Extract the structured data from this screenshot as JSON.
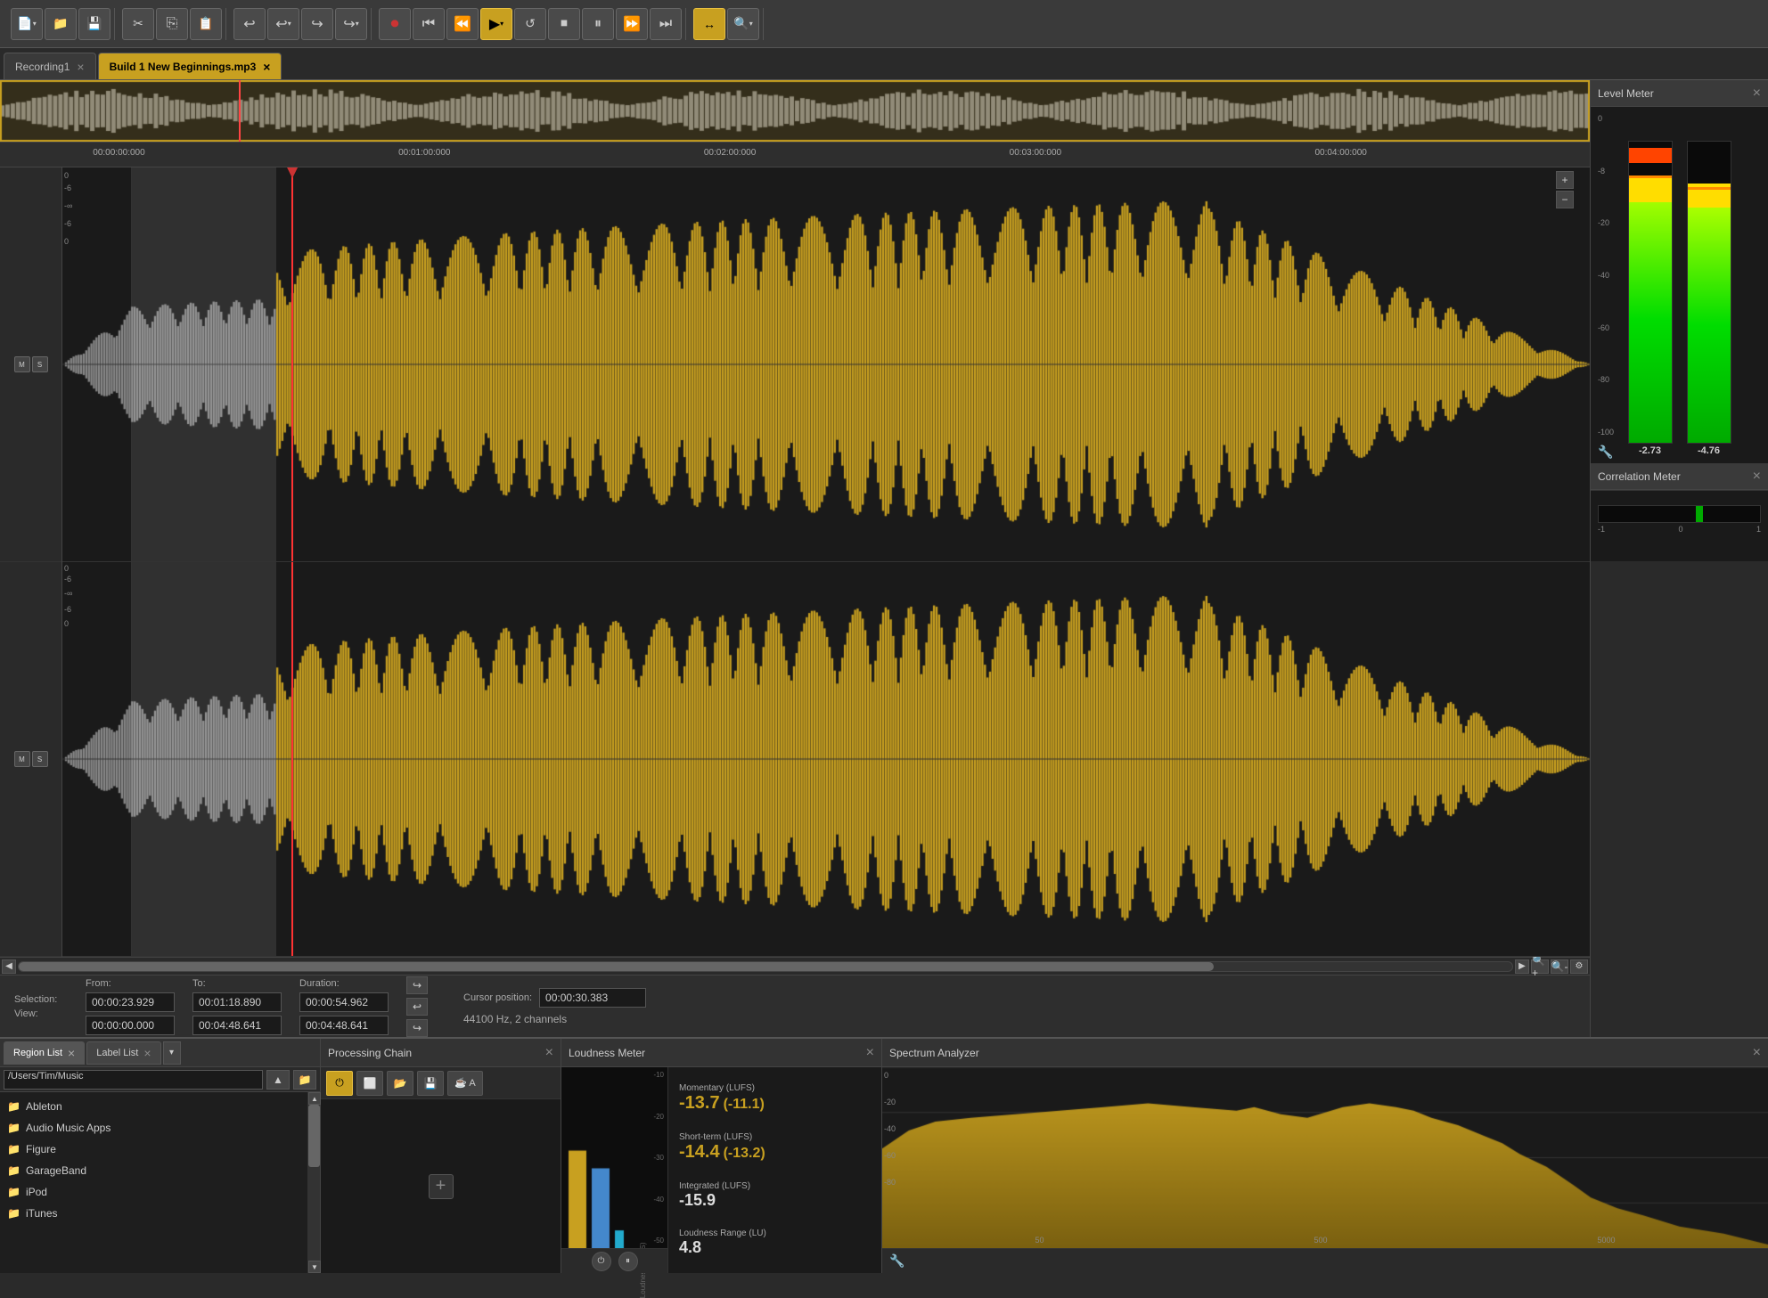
{
  "toolbar": {
    "buttons": [
      {
        "id": "new",
        "label": "📄▾",
        "icon": "new-file-icon"
      },
      {
        "id": "open",
        "label": "📁",
        "icon": "open-icon"
      },
      {
        "id": "save",
        "label": "💾",
        "icon": "save-icon"
      },
      {
        "id": "cut",
        "label": "✂",
        "icon": "cut-icon"
      },
      {
        "id": "copy",
        "label": "⎘",
        "icon": "copy-icon"
      },
      {
        "id": "paste",
        "label": "📋",
        "icon": "paste-icon"
      },
      {
        "id": "undo",
        "label": "↩",
        "icon": "undo-icon"
      },
      {
        "id": "undo2",
        "label": "↩▾",
        "icon": "undo-dropdown-icon"
      },
      {
        "id": "redo",
        "label": "↪",
        "icon": "redo-icon"
      },
      {
        "id": "redo2",
        "label": "↪▾",
        "icon": "redo-dropdown-icon"
      },
      {
        "id": "record",
        "label": "⏺",
        "icon": "record-icon"
      },
      {
        "id": "skip-start",
        "label": "⏮",
        "icon": "skip-start-icon"
      },
      {
        "id": "rewind",
        "label": "⏪",
        "icon": "rewind-icon"
      },
      {
        "id": "play",
        "label": "▶▾",
        "icon": "play-icon",
        "active": true
      },
      {
        "id": "loop",
        "label": "🔁",
        "icon": "loop-icon"
      },
      {
        "id": "stop",
        "label": "⏹",
        "icon": "stop-icon"
      },
      {
        "id": "pause",
        "label": "⏸",
        "icon": "pause-icon"
      },
      {
        "id": "ffwd",
        "label": "⏩",
        "icon": "ffwd-icon"
      },
      {
        "id": "skip-end",
        "label": "⏭",
        "icon": "skip-end-icon"
      },
      {
        "id": "auto-scroll",
        "label": "↔",
        "icon": "auto-scroll-icon",
        "active": true
      },
      {
        "id": "zoom",
        "label": "🔍▾",
        "icon": "zoom-icon"
      }
    ]
  },
  "tabs": [
    {
      "id": "recording1",
      "label": "Recording1",
      "active": false
    },
    {
      "id": "build1",
      "label": "Build 1 New Beginnings.mp3",
      "active": true
    }
  ],
  "right_panel": {
    "level_meter": {
      "title": "Level Meter",
      "left_value": "-2.73",
      "right_value": "-4.76",
      "scale": [
        "0",
        "-8",
        "-20",
        "-40",
        "-60",
        "-80",
        "-100"
      ]
    },
    "correlation_meter": {
      "title": "Correlation Meter",
      "labels": [
        "-1",
        "0",
        "1"
      ]
    }
  },
  "info_bar": {
    "selection_label": "Selection:",
    "view_label": "View:",
    "from_label": "From:",
    "to_label": "To:",
    "duration_label": "Duration:",
    "sel_from": "00:00:23.929",
    "sel_to": "00:01:18.890",
    "sel_duration": "00:00:54.962",
    "view_from": "00:00:00.000",
    "view_to": "00:04:48.641",
    "view_duration": "00:04:48.641",
    "cursor_label": "Cursor position:",
    "cursor_value": "00:00:30.383",
    "sample_info": "44100 Hz, 2 channels"
  },
  "timeline": {
    "marks": [
      {
        "pos": "0%",
        "label": "00:00:00:000"
      },
      {
        "pos": "20%",
        "label": "00:01:00:000"
      },
      {
        "pos": "40%",
        "label": "00:02:00:000"
      },
      {
        "pos": "60%",
        "label": "00:03:00:000"
      },
      {
        "pos": "80%",
        "label": "00:04:00:000"
      }
    ]
  },
  "bottom_panels": {
    "region_list": {
      "tab_label": "Region List",
      "active": true
    },
    "label_list": {
      "tab_label": "Label List",
      "active": false
    },
    "file_path": "/Users/Tim/Music",
    "files": [
      {
        "name": "Ableton",
        "type": "folder"
      },
      {
        "name": "Audio Music Apps",
        "type": "folder"
      },
      {
        "name": "Figure",
        "type": "folder"
      },
      {
        "name": "GarageBand",
        "type": "folder"
      },
      {
        "name": "iPod",
        "type": "folder"
      },
      {
        "name": "iTunes",
        "type": "folder"
      }
    ],
    "processing_chain": {
      "title": "Processing Chain",
      "add_label": "+"
    },
    "loudness_meter": {
      "title": "Loudness Meter",
      "momentary_label": "Momentary (LUFS)",
      "momentary_value": "-13.7",
      "momentary_sub": "(-11.1)",
      "shortterm_label": "Short-term (LUFS)",
      "shortterm_value": "-14.4",
      "shortterm_sub": "(-13.2)",
      "integrated_label": "Integrated (LUFS)",
      "integrated_value": "-15.9",
      "range_label": "Loudness Range (LU)",
      "range_value": "4.8",
      "scale_labels": [
        "-10",
        "-20",
        "-30",
        "-40",
        "-50"
      ],
      "time_label": "Time (s)",
      "lufs_label": "Loudness (LUFS)"
    },
    "spectrum_analyzer": {
      "title": "Spectrum Analyzer",
      "scale_labels": [
        "0",
        "-20",
        "-40",
        "-60",
        "-80"
      ],
      "freq_labels": [
        "50",
        "500",
        "5000"
      ]
    }
  }
}
